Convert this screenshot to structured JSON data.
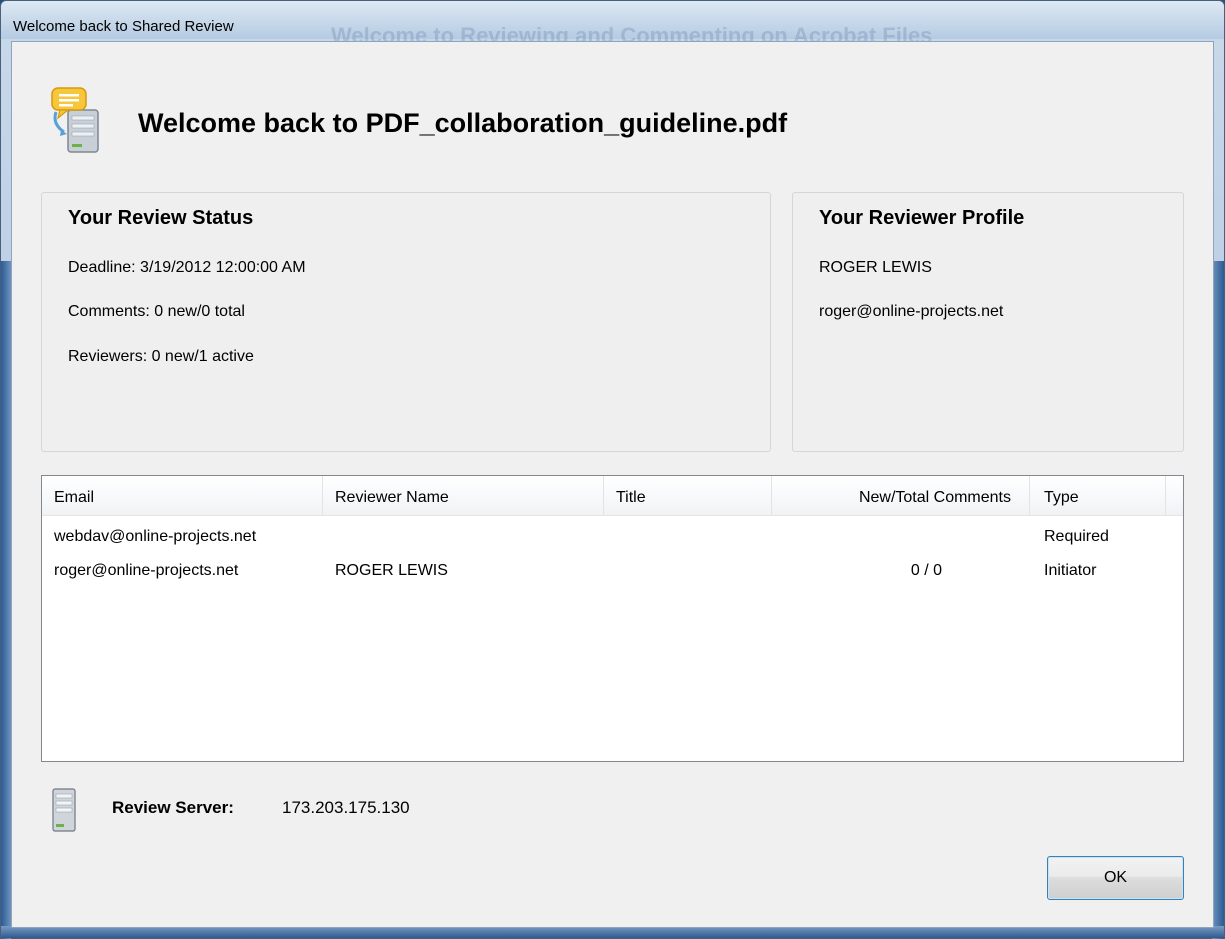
{
  "window": {
    "title": "Welcome back to Shared Review",
    "background_title": "Welcome to Reviewing and Commenting on Acrobat Files"
  },
  "header": {
    "icon": "shared-review-icon",
    "heading": "Welcome back to PDF_collaboration_guideline.pdf"
  },
  "review_status": {
    "heading": "Your Review Status",
    "deadline": "Deadline: 3/19/2012 12:00:00 AM",
    "comments": "Comments: 0 new/0 total",
    "reviewers": "Reviewers: 0 new/1 active"
  },
  "reviewer_profile": {
    "heading": "Your Reviewer Profile",
    "name": "ROGER LEWIS",
    "email": "roger@online-projects.net"
  },
  "reviewers_table": {
    "columns": [
      "Email",
      "Reviewer Name",
      "Title",
      "New/Total Comments",
      "Type"
    ],
    "rows": [
      {
        "email": "webdav@online-projects.net",
        "name": "",
        "title": "",
        "comments": "",
        "type": "Required"
      },
      {
        "email": "roger@online-projects.net",
        "name": "ROGER LEWIS",
        "title": "",
        "comments": "0 / 0",
        "type": "Initiator"
      }
    ]
  },
  "server": {
    "icon": "server-icon",
    "label": "Review Server:",
    "value": "173.203.175.130"
  },
  "buttons": {
    "ok": "OK"
  },
  "colors": {
    "dialog_bg": "#f0f0f0",
    "frame": "#b9cde3",
    "button_border": "#3c7fb1"
  }
}
